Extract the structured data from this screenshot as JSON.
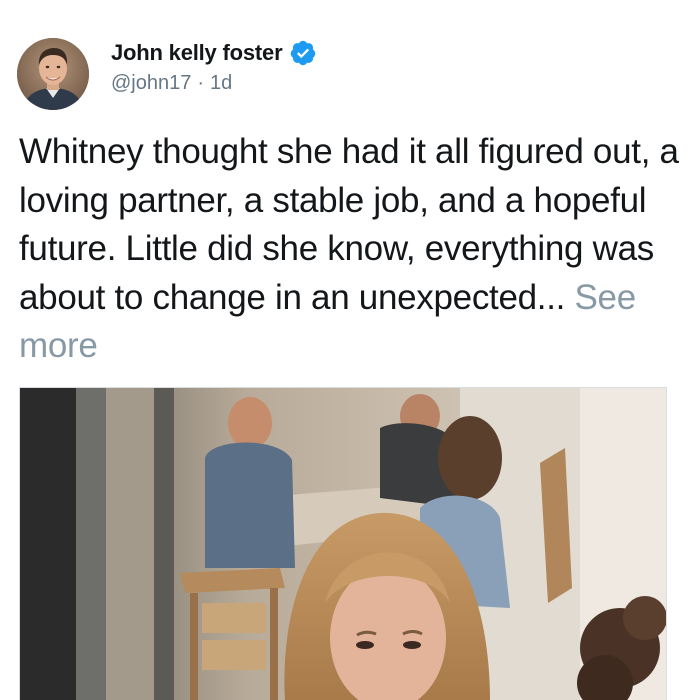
{
  "tweet": {
    "author": {
      "display_name": "John kelly foster",
      "handle": "@john17",
      "separator": "·",
      "timestamp": "1d",
      "verified_icon": "verified-badge-icon",
      "avatar_icon": "profile-photo"
    },
    "text": {
      "body": "Whitney thought she had it all figured out, a loving partner, a stable job, and a hopeful future. Little did she know, everything was about to change in an unexpected...",
      "see_more_label": "See more"
    },
    "media": {
      "type": "photo"
    }
  },
  "colors": {
    "verified_blue": "#1d9bf0",
    "text_primary": "#14171a",
    "text_secondary": "#657786",
    "see_more": "#8899a6"
  }
}
